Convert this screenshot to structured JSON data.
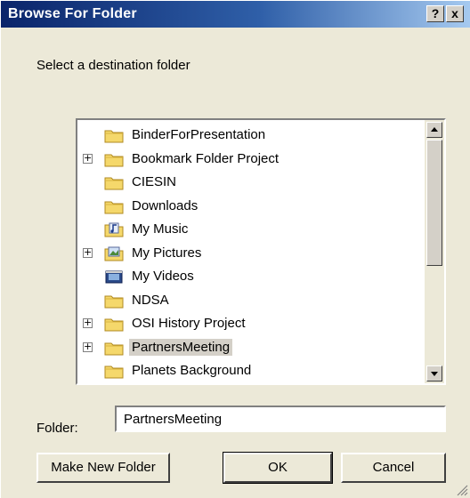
{
  "window": {
    "title": "Browse For Folder",
    "help_label": "?",
    "close_label": "x"
  },
  "prompt": "Select a destination folder",
  "tree": {
    "items": [
      {
        "label": "BinderForPresentation",
        "icon": "folder-icon",
        "expandable": false,
        "selected": false
      },
      {
        "label": "Bookmark Folder Project",
        "icon": "folder-icon",
        "expandable": true,
        "selected": false
      },
      {
        "label": "CIESIN",
        "icon": "folder-icon",
        "expandable": false,
        "selected": false
      },
      {
        "label": "Downloads",
        "icon": "folder-icon",
        "expandable": false,
        "selected": false
      },
      {
        "label": "My Music",
        "icon": "music-folder-icon",
        "expandable": false,
        "selected": false
      },
      {
        "label": "My Pictures",
        "icon": "pictures-folder-icon",
        "expandable": true,
        "selected": false
      },
      {
        "label": "My Videos",
        "icon": "videos-folder-icon",
        "expandable": false,
        "selected": false
      },
      {
        "label": "NDSA",
        "icon": "folder-icon",
        "expandable": false,
        "selected": false
      },
      {
        "label": "OSI History Project",
        "icon": "folder-icon",
        "expandable": true,
        "selected": false
      },
      {
        "label": "PartnersMeeting",
        "icon": "folder-icon",
        "expandable": true,
        "selected": true
      },
      {
        "label": "Planets Background",
        "icon": "folder-icon",
        "expandable": false,
        "selected": false
      }
    ],
    "expander_symbol": "+"
  },
  "folder": {
    "label": "Folder:",
    "value": "PartnersMeeting"
  },
  "buttons": {
    "make_new_folder": "Make New Folder",
    "ok": "OK",
    "cancel": "Cancel"
  },
  "colors": {
    "titlebar_start": "#0a246a",
    "titlebar_end": "#a6caf0",
    "dialog_bg": "#ece9d8",
    "folder_fill": "#f5d86b",
    "selection_bg": "#d4d0c8"
  }
}
